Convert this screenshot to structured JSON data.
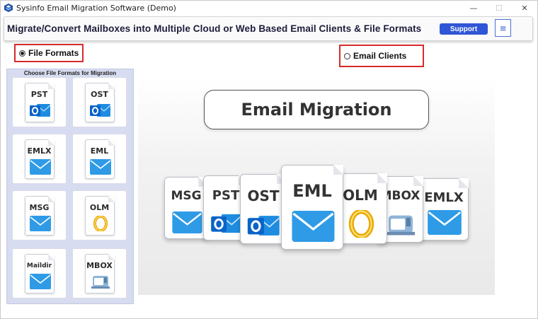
{
  "window": {
    "title": "Sysinfo Email Migration Software (Demo)",
    "controls": {
      "minimize": "—",
      "maximize": "☐",
      "close": "✕"
    }
  },
  "header": {
    "title": "Migrate/Convert Mailboxes into Multiple Cloud or Web Based Email Clients & File Formats",
    "support_label": "Support",
    "menu_icon": "≡"
  },
  "options": {
    "file_formats": {
      "label": "File Formats",
      "selected": true
    },
    "email_clients": {
      "label": "Email Clients",
      "selected": false
    }
  },
  "panel": {
    "title": "Choose File Formats for Migration",
    "tiles": [
      {
        "label": "PST",
        "icon": "outlook-icon"
      },
      {
        "label": "OST",
        "icon": "outlook-icon"
      },
      {
        "label": "EMLX",
        "icon": "envelope-icon"
      },
      {
        "label": "EML",
        "icon": "envelope-icon"
      },
      {
        "label": "MSG",
        "icon": "envelope-icon"
      },
      {
        "label": "OLM",
        "icon": "olm-ring-icon"
      },
      {
        "label": "Maildir",
        "icon": "envelope-icon"
      },
      {
        "label": "MBOX",
        "icon": "mailbox-icon"
      }
    ]
  },
  "banner": {
    "title": "Email Migration",
    "docs": [
      "MSG",
      "PST",
      "OST",
      "EML",
      "OLM",
      "MBOX",
      "EMLX"
    ]
  },
  "colors": {
    "accent": "#2f56d6",
    "highlight_border": "#d62b2b",
    "panel_bg": "#d8dcf0",
    "envelope_blue": "#2f9be6",
    "outlook_blue": "#0a64c8",
    "olm_gold": "#e8a800"
  }
}
